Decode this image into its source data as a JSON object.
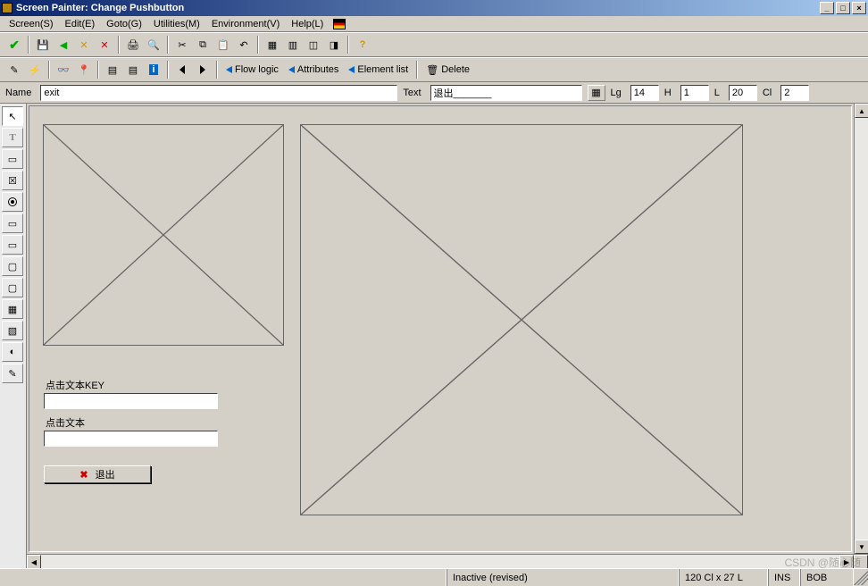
{
  "title": "Screen Painter:   Change Pushbutton",
  "menu": [
    {
      "label": "Screen(S)"
    },
    {
      "label": "Edit(E)"
    },
    {
      "label": "Goto(G)"
    },
    {
      "label": "Utilities(M)"
    },
    {
      "label": "Environment(V)"
    },
    {
      "label": "Help(L)"
    }
  ],
  "toolbar2": {
    "flow_logic": "Flow logic",
    "attributes": "Attributes",
    "element_list": "Element list",
    "delete": "Delete"
  },
  "fields": {
    "name_label": "Name",
    "name_value": "exit",
    "text_label": "Text",
    "text_value": "退出_______",
    "lg_label": "Lg",
    "lg_value": "14",
    "h_label": "H",
    "h_value": "1",
    "l_label": "L",
    "l_value": "20",
    "cl_label": "Cl",
    "cl_value": "2"
  },
  "design": {
    "label1": "点击文本KEY",
    "label2": "点击文本",
    "button_label": "退出"
  },
  "status": {
    "state": "Inactive (revised)",
    "coords": "120 Cl x 27 L",
    "ins": "INS",
    "user": "BOB"
  },
  "watermark": "CSDN @随心随"
}
